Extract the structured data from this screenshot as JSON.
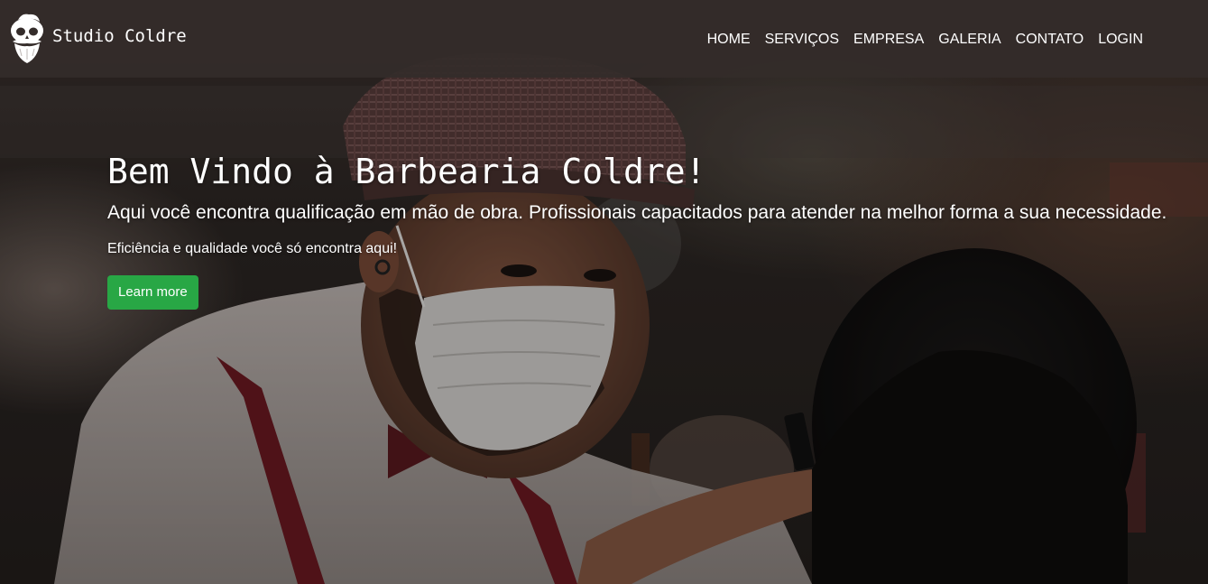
{
  "brand": {
    "name": "Studio Coldre",
    "logo_icon": "bearded-skull-logo-icon"
  },
  "nav": {
    "items": [
      {
        "label": "HOME"
      },
      {
        "label": "SERVIÇOS"
      },
      {
        "label": "EMPRESA"
      },
      {
        "label": "GALERIA"
      },
      {
        "label": "CONTATO"
      },
      {
        "label": "LOGIN"
      }
    ]
  },
  "hero": {
    "title": "Bem Vindo à Barbearia Coldre!",
    "lead": "Aqui você encontra qualificação em mão de obra. Profissionais capacitados para atender na melhor forma a sua necessidade.",
    "subtitle": "Eficiência e qualidade você só encontra aqui!",
    "cta_label": "Learn more"
  },
  "colors": {
    "navbar_bg": "#342c2a",
    "cta_bg": "#28a745",
    "text": "#ffffff"
  }
}
